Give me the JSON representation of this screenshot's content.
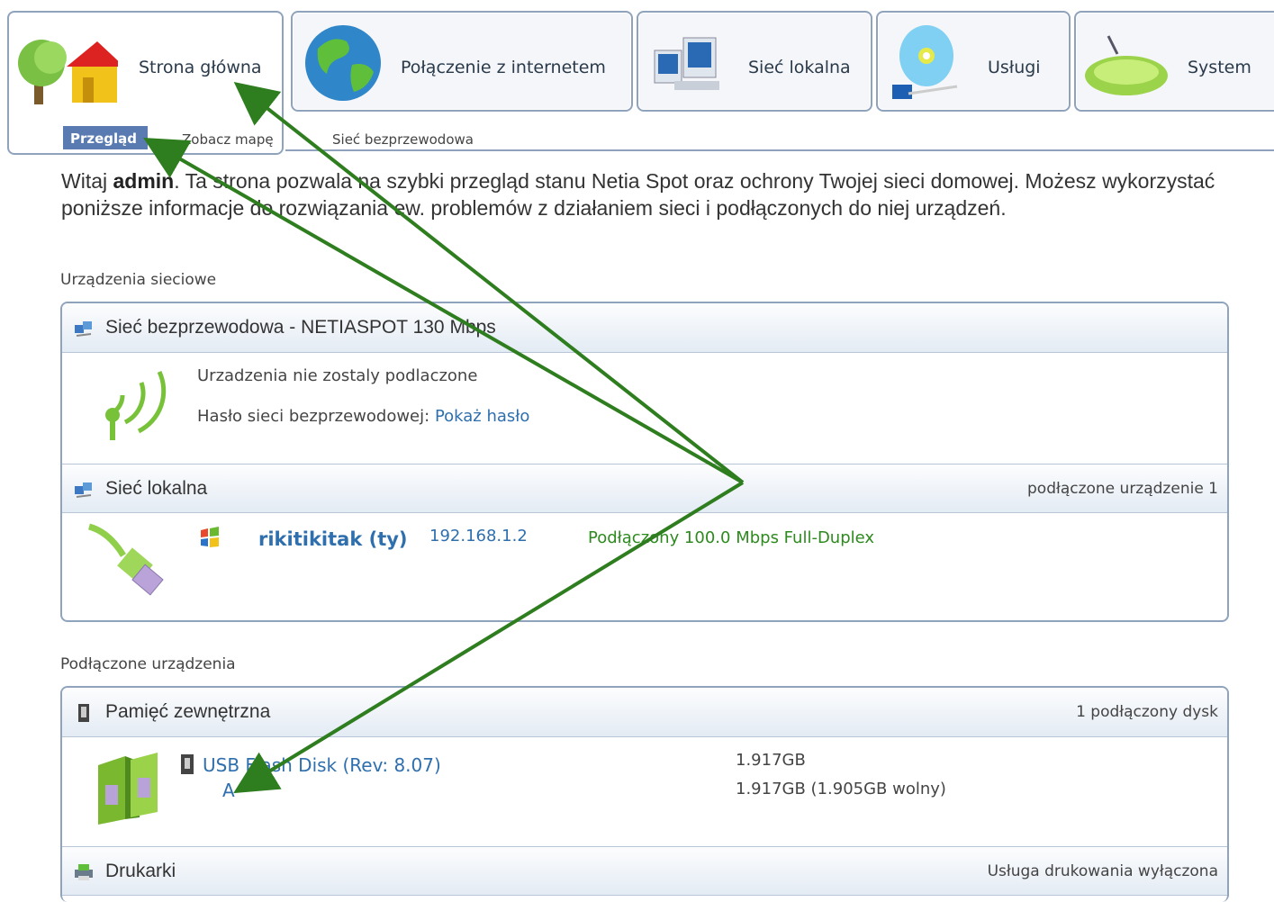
{
  "tabs": [
    {
      "label": "Strona główna",
      "icon": "home-tree-icon"
    },
    {
      "label": "Połączenie z internetem",
      "icon": "globe-icon"
    },
    {
      "label": "Sieć lokalna",
      "icon": "computers-icon"
    },
    {
      "label": "Usługi",
      "icon": "cd-disc-icon"
    },
    {
      "label": "System",
      "icon": "system-tray-icon"
    }
  ],
  "subnav": [
    "Przegląd",
    "Zobacz mapę",
    "Sieć bezprzewodowa"
  ],
  "intro": {
    "part1": "Witaj ",
    "user": "admin",
    "part2": ". Ta strona pozwala na szybki przegląd stanu Netia Spot oraz ochrony Twojej sieci domowej. Możesz wykorzystać poniższe informacje do rozwiązania ew. problemów z działaniem sieci i podłączonych do niej urządzeń."
  },
  "network_section": {
    "title": "Urządzenia sieciowe",
    "wireless": {
      "title": "Sieć bezprzewodowa - NETIASPOT 130 Mbps",
      "status": "Urzadzenia nie zostaly podlaczone",
      "password_label": "Hasło sieci bezprzewodowej:",
      "password_link": "Pokaż hasło"
    },
    "lan": {
      "title": "Sieć lokalna",
      "count": "podłączone urządzenie 1",
      "device": {
        "name": "rikitikitak (ty)",
        "ip": "192.168.1.2",
        "status": "Podłączony 100.0 Mbps Full-Duplex"
      }
    }
  },
  "devices_section": {
    "title": "Podłączone urządzenia",
    "storage": {
      "title": "Pamięć zewnętrzna",
      "count": "1 podłączony dysk",
      "disk_name": "USB Flash Disk (Rev: 8.07)",
      "partition": "A",
      "size": "1.917GB",
      "free": "1.917GB (1.905GB wolny)"
    },
    "printers": {
      "title": "Drukarki",
      "status": "Usługa drukowania wyłączona"
    }
  },
  "colors": {
    "accent": "#5a7bb1",
    "border": "#8fa3bd",
    "link": "#2f6fae",
    "status_green": "#2d8a1e",
    "annotation_arrow": "#2e7d1e"
  }
}
